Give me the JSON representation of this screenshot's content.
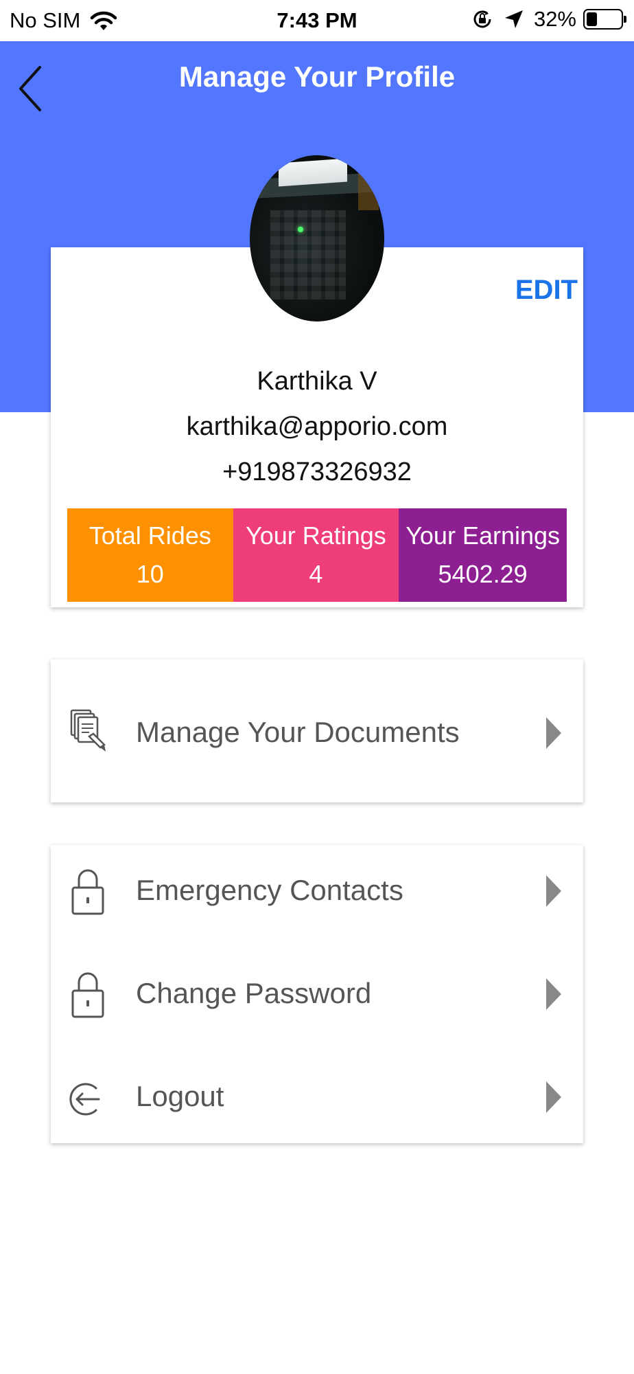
{
  "status_bar": {
    "carrier": "No SIM",
    "time": "7:43 PM",
    "battery_percent": "32%",
    "battery_level": 0.32
  },
  "header": {
    "title": "Manage Your Profile",
    "background_color": "#5276fd",
    "back_icon": "chevron-left-icon"
  },
  "profile": {
    "edit_label": "EDIT",
    "name": "Karthika V",
    "email": "karthika@apporio.com",
    "phone": "+919873326932"
  },
  "stats": [
    {
      "label": "Total Rides",
      "value": "10",
      "color": "#ff9100"
    },
    {
      "label": "Your Ratings",
      "value": "4",
      "color": "#ee3d77"
    },
    {
      "label": "Your Earnings",
      "value": "5402.29",
      "color": "#8e1f93"
    }
  ],
  "menu": {
    "documents": {
      "label": "Manage Your Documents",
      "icon": "documents-icon"
    },
    "emergency": {
      "label": "Emergency Contacts",
      "icon": "lock-icon"
    },
    "password": {
      "label": "Change Password",
      "icon": "lock-icon"
    },
    "logout": {
      "label": "Logout",
      "icon": "logout-icon"
    }
  }
}
